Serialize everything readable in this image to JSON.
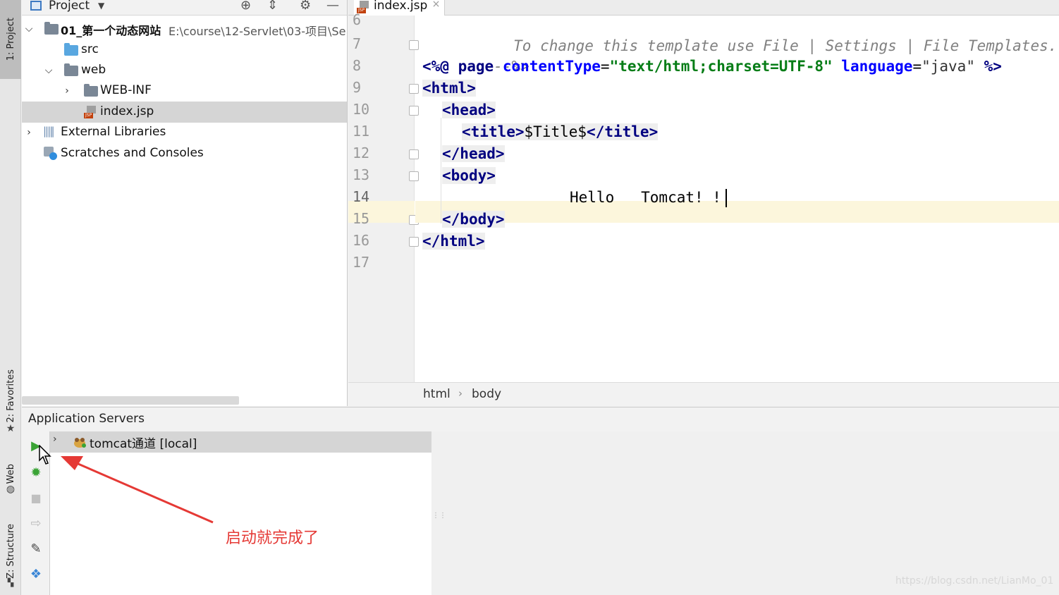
{
  "side_strip": {
    "project_tab": "1: Project",
    "favorites_tab": "2: Favorites",
    "web_tab": "Web",
    "structure_tab": "Z: Structure"
  },
  "project_panel": {
    "title": "Project",
    "tree": [
      {
        "label": "01_第一个动态网站",
        "path": "E:\\course\\12-Servlet\\03-项目\\Se"
      },
      {
        "label": "src"
      },
      {
        "label": "web"
      },
      {
        "label": "WEB-INF"
      },
      {
        "label": "index.jsp"
      },
      {
        "label": "External Libraries"
      },
      {
        "label": "Scratches and Consoles"
      }
    ]
  },
  "editor": {
    "tab_label": "index.jsp",
    "tab_close": "×",
    "line_numbers": [
      "6",
      "7",
      "8",
      "9",
      "10",
      "11",
      "12",
      "13",
      "14",
      "15",
      "16",
      "17"
    ],
    "code": {
      "l6": "To change this template use File | Settings | File Templates.",
      "l7": "--%>",
      "l8_open": "<%@",
      "l8_page": "page",
      "l8_ct_attr": "contentType",
      "l8_ct_val": "\"text/html;charset=UTF-8\"",
      "l8_lang_attr": "language",
      "l8_lang_val": "\"java\"",
      "l8_close": "%>",
      "l9": "html",
      "l10": "head",
      "l11_tag": "title",
      "l11_text": "$Title$",
      "l12": "/head",
      "l13": "body",
      "l14": "Hello   Tomcat! !",
      "l15": "/body",
      "l16": "/html"
    },
    "breadcrumb": [
      "html",
      "body"
    ]
  },
  "servers": {
    "title": "Application Servers",
    "rows": [
      {
        "label": "tomcat通道 [local]"
      }
    ]
  },
  "annotation": {
    "text": "启动就完成了",
    "color": "#e53935"
  },
  "watermark": "https://blog.csdn.net/LianMo_01"
}
